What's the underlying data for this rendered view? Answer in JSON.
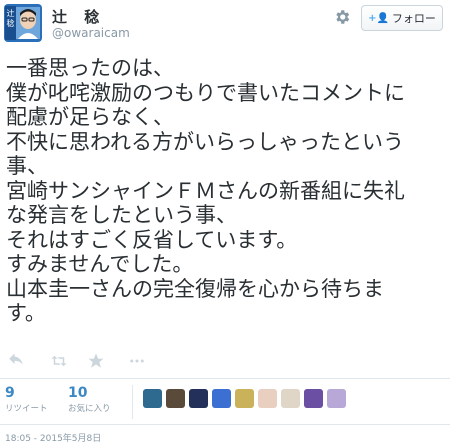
{
  "user": {
    "display_name": "辻 稔",
    "handle": "@owaraicam",
    "avatar_label": "辻稔"
  },
  "follow_button": {
    "label": "フォロー"
  },
  "tweet": {
    "lines": [
      "一番思ったのは、",
      "僕が叱咤激励のつもりで書いたコメントに",
      "配慮が足らなく、",
      "不快に思われる方がいらっしゃったという",
      "事、",
      "宮崎サンシャインＦＭさんの新番組に失礼",
      "な発言をしたという事、",
      "それはすごく反省しています。",
      "すみませんでした。",
      "山本圭一さんの完全復帰を心から待ちま",
      "す。"
    ]
  },
  "actions": [
    "reply-icon",
    "retweet-icon",
    "favorite-icon",
    "more-icon"
  ],
  "stats": {
    "retweets": {
      "count": "9",
      "label": "リツイート"
    },
    "favorites": {
      "count": "10",
      "label": "お気に入り"
    }
  },
  "favorited_by_colors": [
    "#2e6a8f",
    "#5a4a3a",
    "#22305a",
    "#3b6fd1",
    "#c9b25a",
    "#e8cfc0",
    "#e0d6c8",
    "#6a4fa3",
    "#b7a8d8"
  ],
  "timestamp": "18:05 - 2015年5月8日"
}
